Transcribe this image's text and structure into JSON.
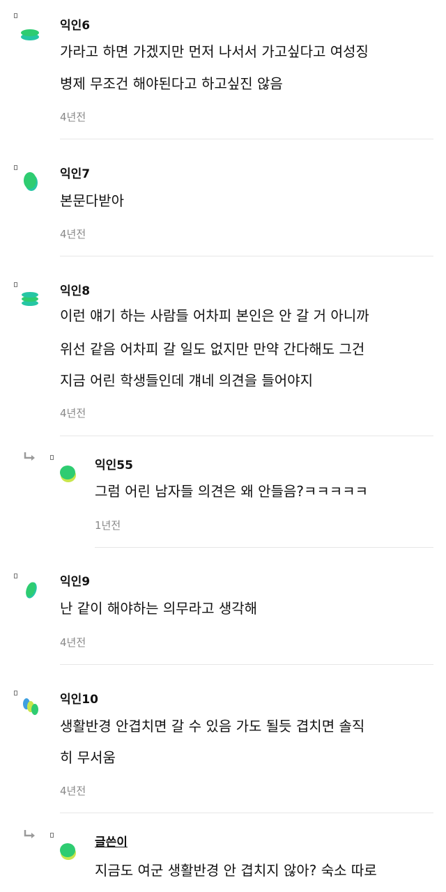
{
  "colors": {
    "avatar_green": "#2ecc71",
    "avatar_teal": "#26c6a4",
    "avatar_yellow": "#c8e64c",
    "avatar_blue": "#3fa0e0",
    "time_gray": "#888888",
    "divider": "#e6e6e6"
  },
  "comments": [
    {
      "nickname": "익인6",
      "lines": [
        "가라고 하면 가겠지만 먼저 나서서 가고싶다고 여성징",
        "병제 무조건 해야된다고 하고싶진 않음"
      ],
      "time": "4년전",
      "avatar_icon": "stacked-discs-icon"
    },
    {
      "nickname": "익인7",
      "lines": [
        "본문다받아"
      ],
      "time": "4년전",
      "avatar_icon": "coin-icon"
    },
    {
      "nickname": "익인8",
      "lines": [
        "이런 얘기 하는 사람들 어차피 본인은 안 갈 거 아니까",
        "위선 같음 어차피 갈 일도 없지만 만약 간다해도 그건",
        "지금 어린 학생들인데 걔네 의견을 들어야지"
      ],
      "time": "4년전",
      "avatar_icon": "triple-discs-icon"
    },
    {
      "nickname": "익인55",
      "lines": [
        "그럼 어린 남자들 의견은 왜 안들음?ㅋㅋㅋㅋㅋ"
      ],
      "time": "1년전",
      "avatar_icon": "coin-icon",
      "is_reply": true
    },
    {
      "nickname": "익인9",
      "lines": [
        "난 같이 해야하는 의무라고 생각해"
      ],
      "time": "4년전",
      "avatar_icon": "tilted-coin-icon"
    },
    {
      "nickname": "익인10",
      "lines": [
        "생활반경 안겹치면 갈 수 있음 가도 될듯 겹치면 솔직",
        "히 무서움"
      ],
      "time": "4년전",
      "avatar_icon": "multicolor-discs-icon"
    },
    {
      "nickname": "글쓴이",
      "lines": [
        "지금도 여군 생활반경 안 겹치지 않아? 숙소 따로"
      ],
      "time": "",
      "avatar_icon": "coin-icon",
      "is_reply": true,
      "is_author": true
    }
  ]
}
